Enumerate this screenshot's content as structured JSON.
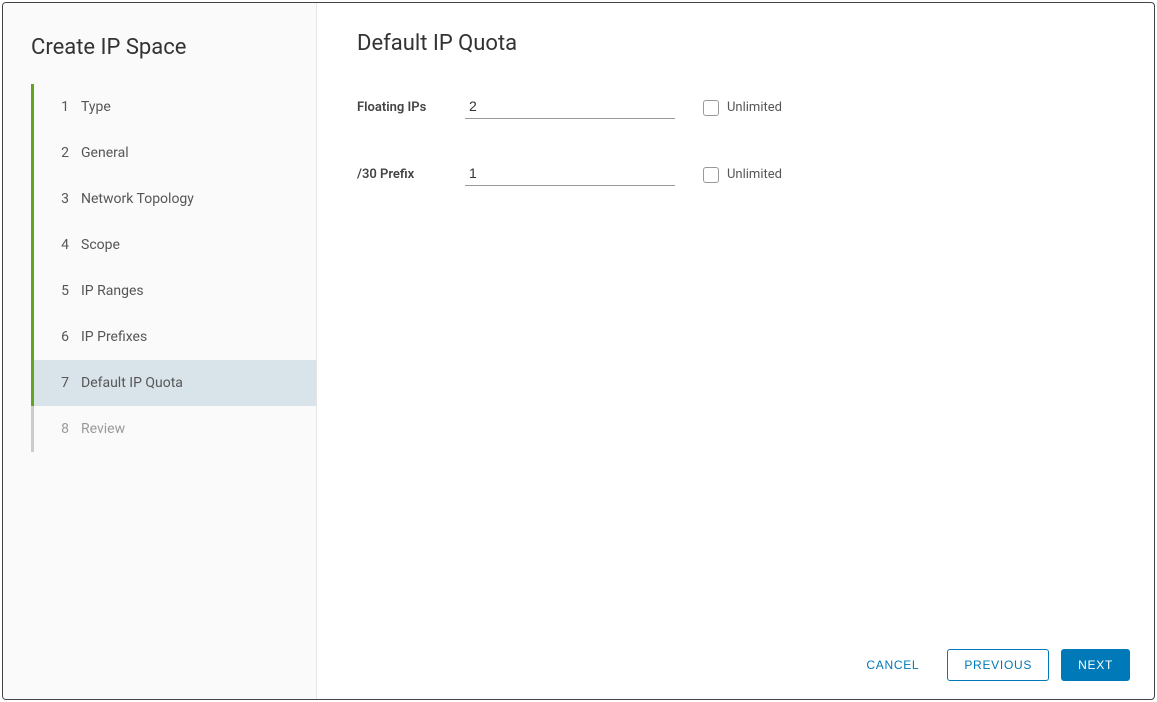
{
  "wizard": {
    "title": "Create IP Space",
    "steps": [
      {
        "num": "1",
        "label": "Type",
        "state": "done"
      },
      {
        "num": "2",
        "label": "General",
        "state": "done"
      },
      {
        "num": "3",
        "label": "Network Topology",
        "state": "done"
      },
      {
        "num": "4",
        "label": "Scope",
        "state": "done"
      },
      {
        "num": "5",
        "label": "IP Ranges",
        "state": "done"
      },
      {
        "num": "6",
        "label": "IP Prefixes",
        "state": "done"
      },
      {
        "num": "7",
        "label": "Default IP Quota",
        "state": "active"
      },
      {
        "num": "8",
        "label": "Review",
        "state": "future"
      }
    ]
  },
  "page": {
    "title": "Default IP Quota",
    "fields": {
      "floating_ips": {
        "label": "Floating IPs",
        "value": "2",
        "unlimited_label": "Unlimited"
      },
      "prefix_30": {
        "label": "/30 Prefix",
        "value": "1",
        "unlimited_label": "Unlimited"
      }
    }
  },
  "footer": {
    "cancel": "Cancel",
    "previous": "Previous",
    "next": "Next"
  }
}
